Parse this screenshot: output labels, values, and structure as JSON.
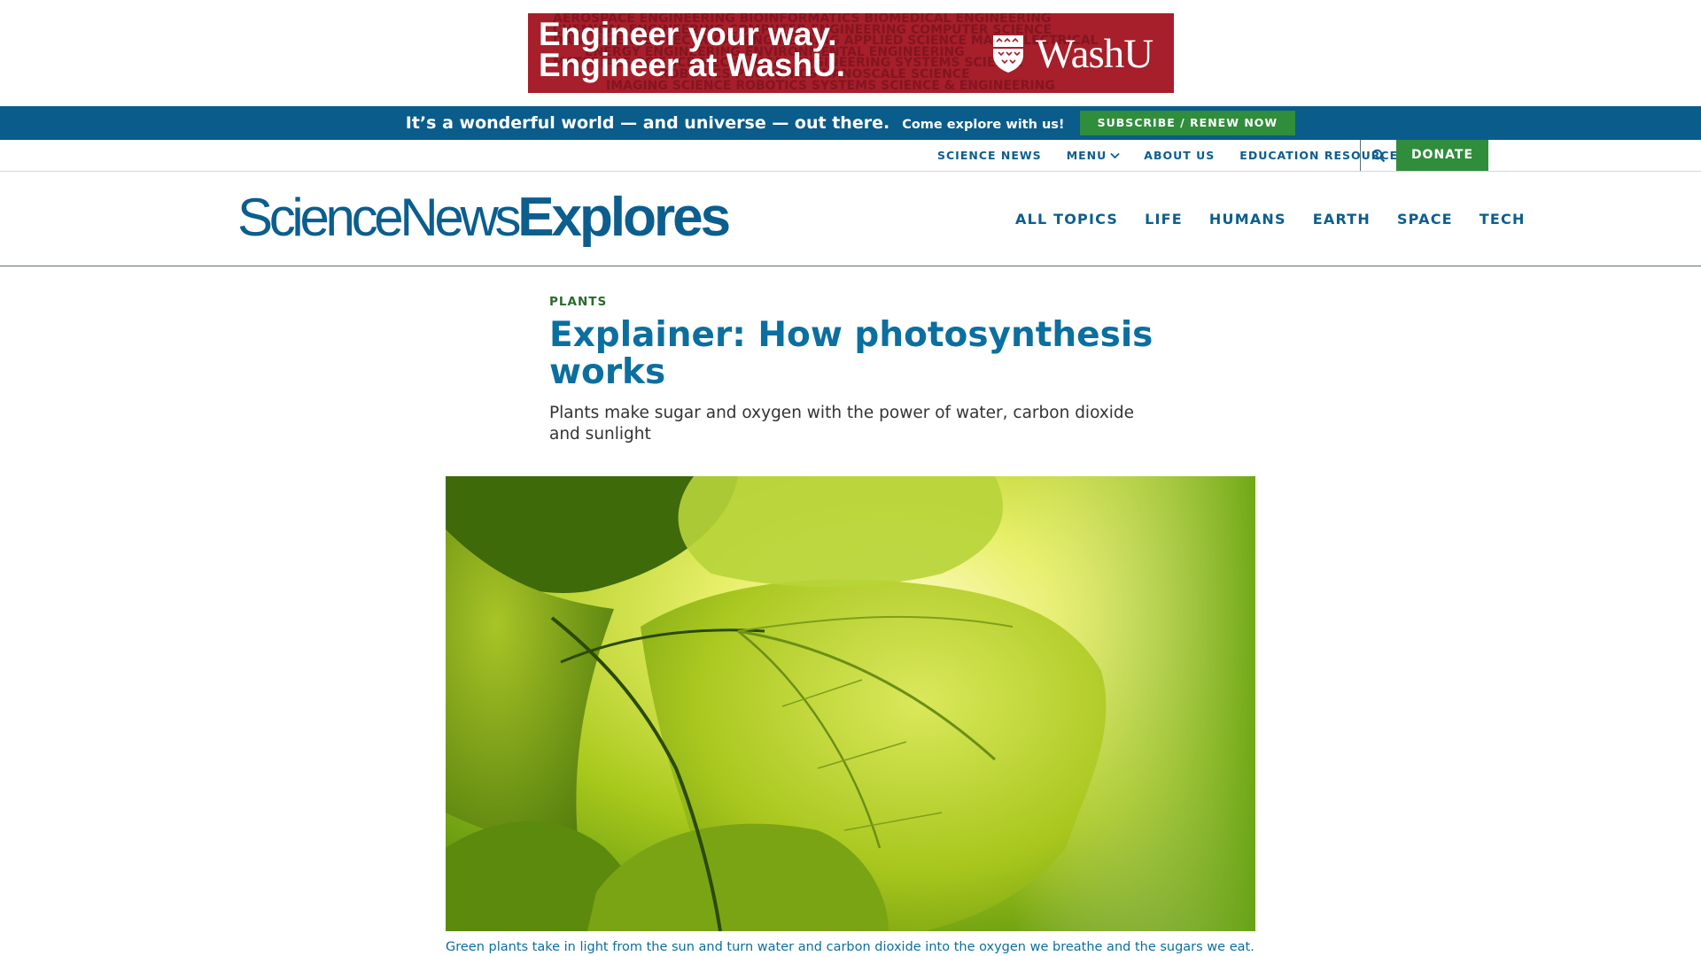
{
  "ad": {
    "bg_lines": [
      "AEROSPACE ENGINEERING BIOINFORMATICS BIOMEDICAL ENGINEERING",
      "CHEMICAL ENGINEERING COMPUTER ENGINEERING COMPUTER SCIENCE",
      "DATA SCIENCE ELECTRICAL ENGINEERING APPLIED SCIENCE MATH ELECTRICAL",
      "ENERGY ENGINEERING ENVIRONMENTAL ENGINEERING",
      "MATERIALS SCIENCE MECHANICAL ENGINEERING SYSTEMS SCIENCE",
      "ROBOTICS PHOTONICS NANOSCALE SCIENCE",
      "IMAGING SCIENCE ROBOTICS SYSTEMS SCIENCE & ENGINEERING"
    ],
    "headline_1": "Engineer your way.",
    "headline_2": "Engineer at WashU.",
    "brand": "WashU",
    "colors": {
      "background": "#a61f2a"
    }
  },
  "promo": {
    "tagline": "It’s a wonderful world — and universe — out there.",
    "subline": "Come explore with us!",
    "button": "SUBSCRIBE / RENEW NOW"
  },
  "utility_nav": {
    "science_news": "SCIENCE NEWS",
    "menu": "MENU",
    "about": "ABOUT US",
    "education": "EDUCATION RESOURCES",
    "search_icon": "search-icon",
    "donate": "DONATE"
  },
  "logo": {
    "part1": "ScienceNews",
    "part2": "Explores"
  },
  "topics": [
    "ALL TOPICS",
    "LIFE",
    "HUMANS",
    "EARTH",
    "SPACE",
    "TECH"
  ],
  "article": {
    "kicker": "PLANTS",
    "title": "Explainer: How photosynthesis works",
    "dek": "Plants make sugar and oxygen with the power of water, carbon dioxide and sunlight",
    "caption": "Green plants take in light from the sun and turn water and carbon dioxide into the oxygen we breathe and the sugars we eat."
  },
  "colors": {
    "brand_blue": "#0b5e8e",
    "promo_bar": "#0a5c8a",
    "green_button": "#2f8d3c",
    "kicker_green": "#2a6b2d"
  }
}
